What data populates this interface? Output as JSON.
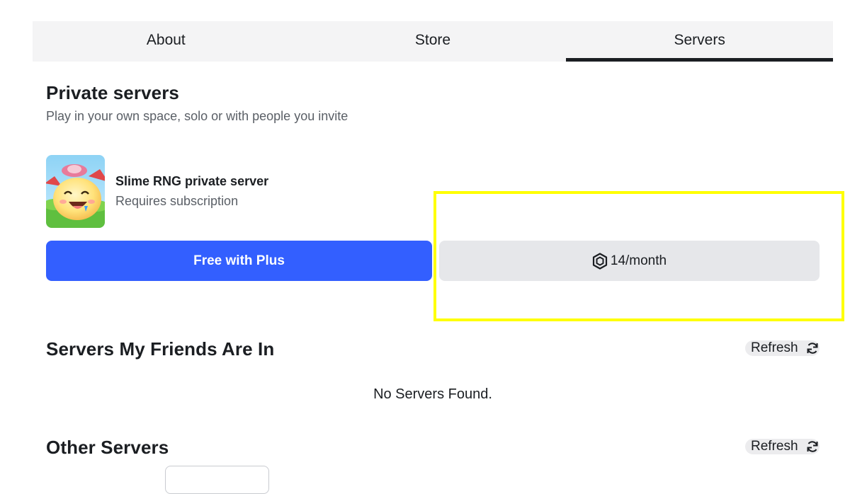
{
  "tabs": [
    {
      "label": "About",
      "active": false
    },
    {
      "label": "Store",
      "active": false
    },
    {
      "label": "Servers",
      "active": true
    }
  ],
  "private_servers": {
    "title": "Private servers",
    "subtitle": "Play in your own space, solo or with people you invite",
    "server_name": "Slime RNG private server",
    "server_requirement": "Requires subscription",
    "free_button_label": "Free with Plus",
    "price_label": "14/month",
    "price_icon": "robux-icon",
    "highlight_color": "#ffff00"
  },
  "friends_servers": {
    "title": "Servers My Friends Are In",
    "refresh_label": "Refresh",
    "empty_message": "No Servers Found."
  },
  "other_servers": {
    "title": "Other Servers",
    "refresh_label": "Refresh"
  },
  "colors": {
    "primary_button": "#335fff",
    "secondary_button": "#e6e7ea",
    "tab_bar": "#f4f4f5",
    "text": "#1b1e22",
    "muted_text": "#5a5f66"
  }
}
